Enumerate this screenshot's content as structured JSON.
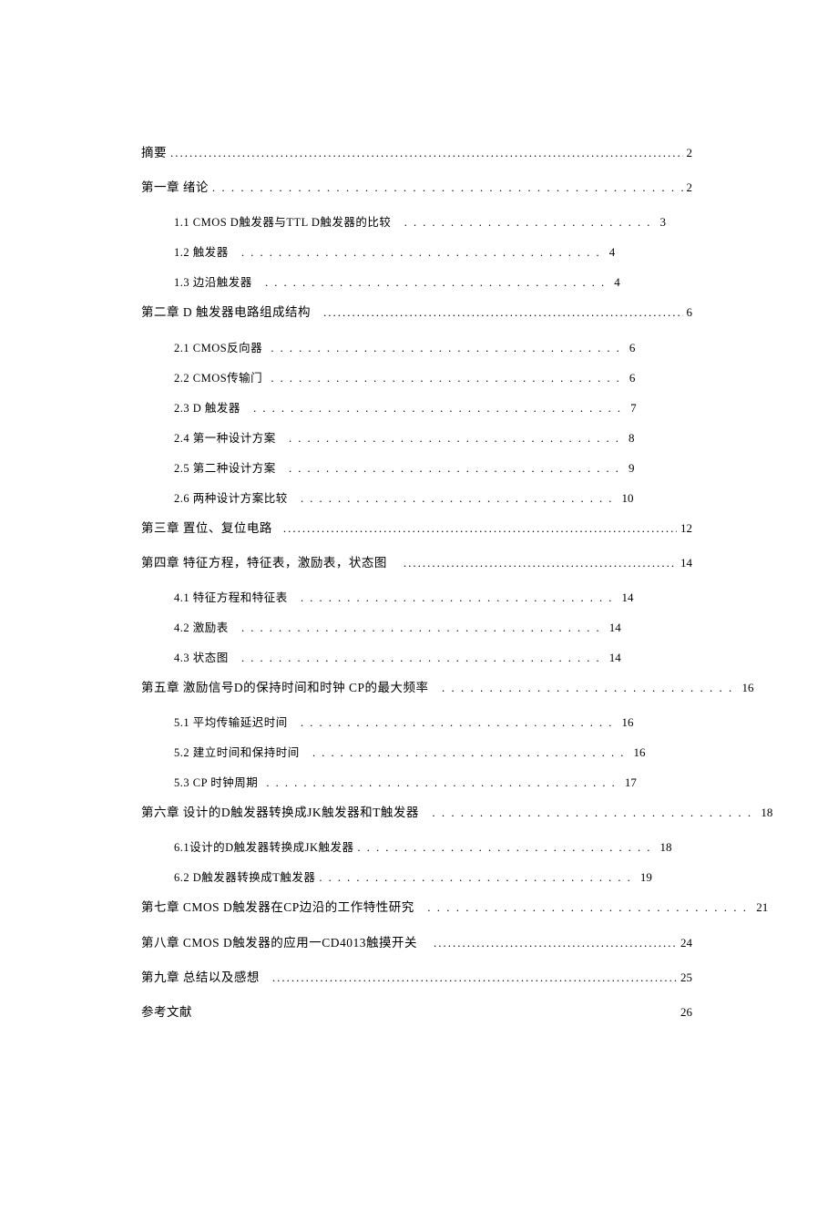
{
  "toc": [
    {
      "kind": "chapter",
      "label": "摘要",
      "page": "2",
      "leaderStyle": "full"
    },
    {
      "kind": "chapter",
      "label": "第一章 绪论",
      "page": "2",
      "leaderStyle": "full-dotted"
    },
    {
      "kind": "sub",
      "label": "1.1  CMOS D触发器与TTL D触发器的比较",
      "page": "3",
      "leaderStyle": "short"
    },
    {
      "kind": "sub",
      "label": "1.2  触发器",
      "page": "4",
      "leaderStyle": "short"
    },
    {
      "kind": "sub",
      "label": "1.3  边沿触发器",
      "page": "4",
      "leaderStyle": "short"
    },
    {
      "kind": "chapter",
      "label": "第二章 D 触发器电路组成结构",
      "page": "6",
      "leaderStyle": "full"
    },
    {
      "kind": "sub",
      "label": "2.1  CMOS反向器",
      "page": "6",
      "leaderStyle": "short"
    },
    {
      "kind": "sub",
      "label": "2.2  CMOS传输门",
      "page": "6",
      "leaderStyle": "short"
    },
    {
      "kind": "sub",
      "label": "2.3  D 触发器",
      "page": "7",
      "leaderStyle": "short"
    },
    {
      "kind": "sub",
      "label": "2.4  第一种设计方案",
      "page": "8",
      "leaderStyle": "short"
    },
    {
      "kind": "sub",
      "label": "2.5  第二种设计方案",
      "page": "9",
      "leaderStyle": "short"
    },
    {
      "kind": "sub",
      "label": "2.6  两种设计方案比较",
      "page": "10",
      "leaderStyle": "short"
    },
    {
      "kind": "chapter",
      "label": "第三章 置位、复位电路",
      "page": "12",
      "leaderStyle": "full"
    },
    {
      "kind": "chapter",
      "label": "第四章 特征方程，特征表，激励表，状态图",
      "page": "14",
      "leaderStyle": "full",
      "topGap": true
    },
    {
      "kind": "sub",
      "label": "4.1  特征方程和特征表",
      "page": "14",
      "leaderStyle": "short"
    },
    {
      "kind": "sub",
      "label": "4.2  激励表",
      "page": "14",
      "leaderStyle": "short"
    },
    {
      "kind": "sub",
      "label": "4.3  状态图",
      "page": "14",
      "leaderStyle": "short"
    },
    {
      "kind": "chapter",
      "label": "第五章 激励信号D的保持时间和时钟 CP的最大频率",
      "page": "16",
      "leaderStyle": "full-dotted"
    },
    {
      "kind": "sub",
      "label": "5.1  平均传输延迟时间",
      "page": "16",
      "leaderStyle": "short"
    },
    {
      "kind": "sub",
      "label": "5.2  建立时间和保持时间",
      "page": "16",
      "leaderStyle": "short"
    },
    {
      "kind": "sub",
      "label": "5.3  CP 时钟周期",
      "page": "17",
      "leaderStyle": "short"
    },
    {
      "kind": "chapter",
      "label": "第六章 设计的D触发器转换成JK触发器和T触发器",
      "page": "18",
      "leaderStyle": "full-dotted"
    },
    {
      "kind": "sub",
      "label": "6.1设计的D触发器转换成JK触发器",
      "page": "18",
      "leaderStyle": "short"
    },
    {
      "kind": "sub",
      "label": "6.2  D触发器转换成T触发器",
      "page": "19",
      "leaderStyle": "short"
    },
    {
      "kind": "chapter",
      "label": "第七章 CMOS D触发器在CP边沿的工作特性研究",
      "page": "21",
      "leaderStyle": "full-dotted",
      "topGap": true
    },
    {
      "kind": "chapter",
      "label": "第八章 CMOS D触发器的应用一CD4013触摸开关",
      "page": "24",
      "leaderStyle": "full",
      "topGap": true
    },
    {
      "kind": "chapter",
      "label": "第九章 总结以及感想",
      "page": "25",
      "leaderStyle": "full",
      "topGap": true
    },
    {
      "kind": "chapter",
      "label": "参考文献",
      "page": "26",
      "leaderStyle": "none",
      "topGap": true
    }
  ],
  "leaderFill": ". . . . . . . . . . . . . . . . . . . . . . . . . . . . . . . . . . . . . . . . . . . . . . . . . . . . . . . . . . . . . . . . . . . . . . . . . . . . . . . . . . . . . . . . . . . . . . . . . . . . . . . . . . . . . . . . . .",
  "leaderFillFull": "........................................................................................................................................................................................"
}
